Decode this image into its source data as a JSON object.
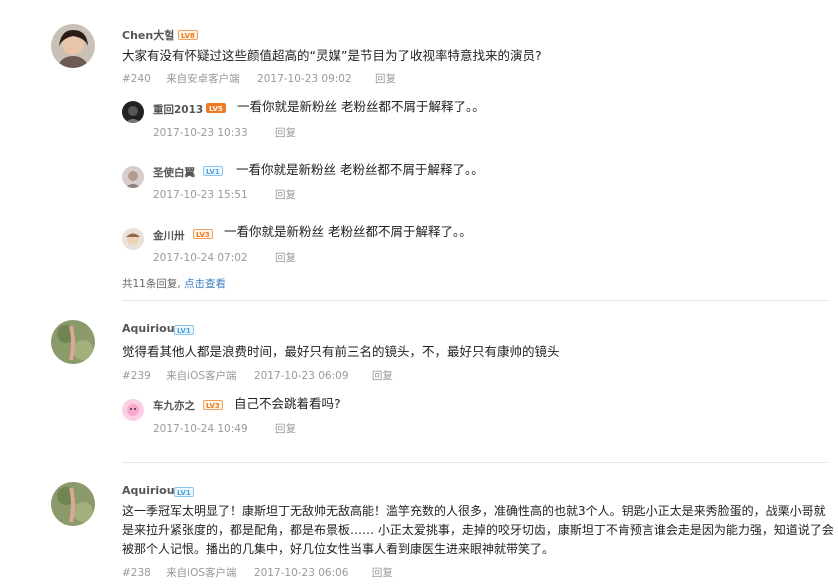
{
  "comments": [
    {
      "user": "Chen大헐",
      "badge": "LV8",
      "text": "大家有没有怀疑过这些颜值超高的“灵媒”是节目为了收视率特意找来的演员?",
      "floor": "#240",
      "source": "来自安卓客户端",
      "time": "2017-10-23 09:02",
      "reply_label": "回复",
      "replies": [
        {
          "user": "重回2013",
          "badge": "LV5",
          "text": "一看你就是新粉丝 老粉丝都不屑于解释了。。",
          "time": "2017-10-23 10:33",
          "reply_label": "回复"
        },
        {
          "user": "圣使白翼",
          "badge": "LV1",
          "text": "一看你就是新粉丝 老粉丝都不屑于解释了。。",
          "time": "2017-10-23 15:51",
          "reply_label": "回复"
        },
        {
          "user": "金川卅",
          "badge": "LV3",
          "text": "一看你就是新粉丝 老粉丝都不屑于解释了。。",
          "time": "2017-10-24 07:02",
          "reply_label": "回复"
        }
      ],
      "summary_prefix": "共11条回复,",
      "summary_link": "点击查看"
    },
    {
      "user": "Aquiriou",
      "badge": "LV1",
      "text": "觉得看其他人都是浪费时间，最好只有前三名的镜头，不，最好只有康帅的镜头",
      "floor": "#239",
      "source": "来自iOS客户端",
      "time": "2017-10-23 06:09",
      "reply_label": "回复",
      "replies": [
        {
          "user": "车九亦之",
          "badge": "LV3",
          "text": "自己不会跳着看吗?",
          "time": "2017-10-24 10:49",
          "reply_label": "回复"
        }
      ]
    },
    {
      "user": "Aquiriou",
      "badge": "LV1",
      "text": "这一季冠军太明显了！康斯坦丁无敌帅无敌高能！滥竽充数的人很多，准确性高的也就3个人。钥匙小正太是来秀脸蛋的，战栗小哥就是来拉升紧张度的，都是配角，都是布景板…… 小正太爱挑事，走掉的咬牙切齿，康斯坦丁不肯预言谁会走是因为能力强，知道说了会被那个人记恨。播出的几集中，好几位女性当事人看到康医生进来眼神就带笑了。",
      "floor": "#238",
      "source": "来自iOS客户端",
      "time": "2017-10-23 06:06",
      "reply_label": "回复"
    }
  ],
  "colors": {
    "accent_link": "#3a7fc4",
    "badge_orange": "#f07a20",
    "badge_blue": "#4aa3df"
  }
}
